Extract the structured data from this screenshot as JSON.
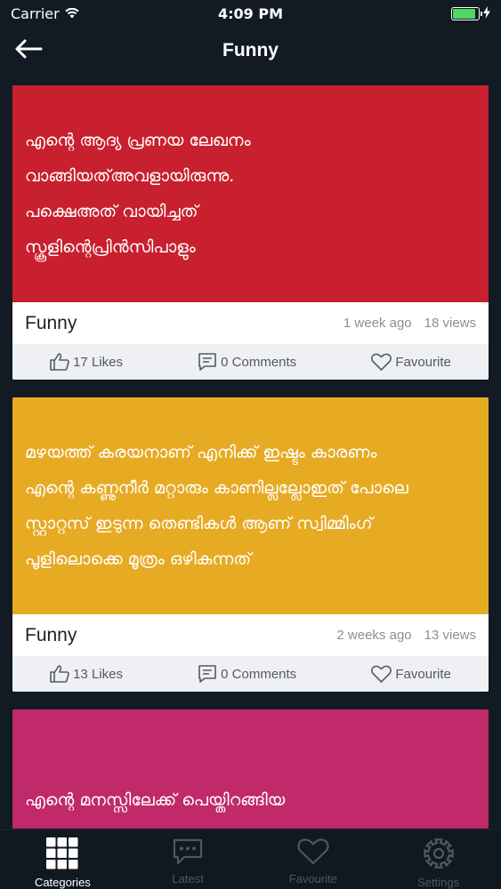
{
  "status_bar": {
    "carrier": "Carrier",
    "time": "4:09 PM",
    "battery_level": 0.9,
    "battery_color": "#4cd964"
  },
  "nav": {
    "title": "Funny",
    "back_icon": "arrow-left-icon"
  },
  "posts": [
    {
      "bg_color": "#c9202f",
      "lines": [
        "എന്റെ ആദ്യ പ്രണയ ലേഖനം",
        "വാങ്ങിയത്അവളായിരുന്നു.",
        "പക്ഷെഅത് വായിച്ചത്",
        "സ്കൂളിന്റെപ്രിൻസിപാളും"
      ],
      "category": "Funny",
      "time_ago": "1 week ago",
      "views": "18 views",
      "likes": "17 Likes",
      "comments": "0 Comments",
      "favourite": "Favourite"
    },
    {
      "bg_color": "#e6aa23",
      "lines": [
        "മഴയത്ത് കരയനാണ് എനിക്ക് ഇഷ്ടം കാരണം",
        "എന്റെ കണ്ണുനീർ മറ്റാരും കാണില്ലല്ലോഇത് പോലെ",
        "സ്റ്റാറ്റസ് ഇടുന്ന തെണ്ടികൾ ആണ് സ്വിമ്മിംഗ്",
        "പൂളിലൊക്കെ മൂത്രം ഒഴികുന്നത്"
      ],
      "category": "Funny",
      "time_ago": "2 weeks ago",
      "views": "13 views",
      "likes": "13 Likes",
      "comments": "0 Comments",
      "favourite": "Favourite"
    },
    {
      "bg_color": "#c02a6a",
      "lines": [
        "",
        "എന്റെ മനസ്സിലേക്ക് പെയ്തിറങ്ങിയ"
      ],
      "category": "",
      "time_ago": "",
      "views": "",
      "likes": "",
      "comments": "",
      "favourite": ""
    }
  ],
  "tabs": [
    {
      "label": "Categories",
      "icon": "grid-icon",
      "active": true
    },
    {
      "label": "Latest",
      "icon": "chat-icon",
      "active": false
    },
    {
      "label": "Favourite",
      "icon": "heart-icon",
      "active": false
    },
    {
      "label": "Settings",
      "icon": "gear-icon",
      "active": false
    }
  ]
}
